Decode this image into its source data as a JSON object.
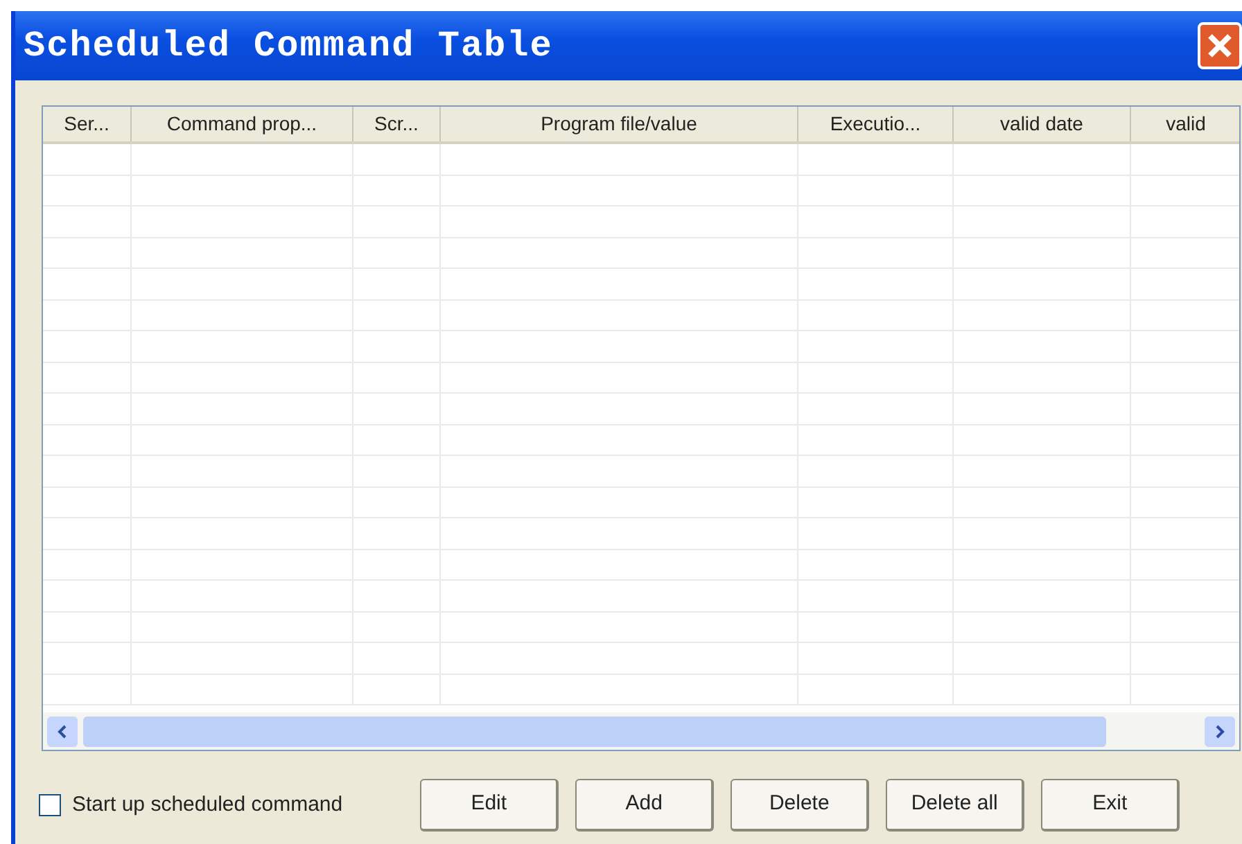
{
  "window": {
    "title": "Scheduled Command Table"
  },
  "table": {
    "columns": [
      "Ser...",
      "Command prop...",
      "Scr...",
      "Program file/value",
      "Executio...",
      "valid date",
      "valid"
    ]
  },
  "start_up": {
    "label": "Start up scheduled command",
    "checked": false
  },
  "buttons": [
    "Edit",
    "Add",
    "Delete",
    "Delete all",
    "Exit"
  ]
}
